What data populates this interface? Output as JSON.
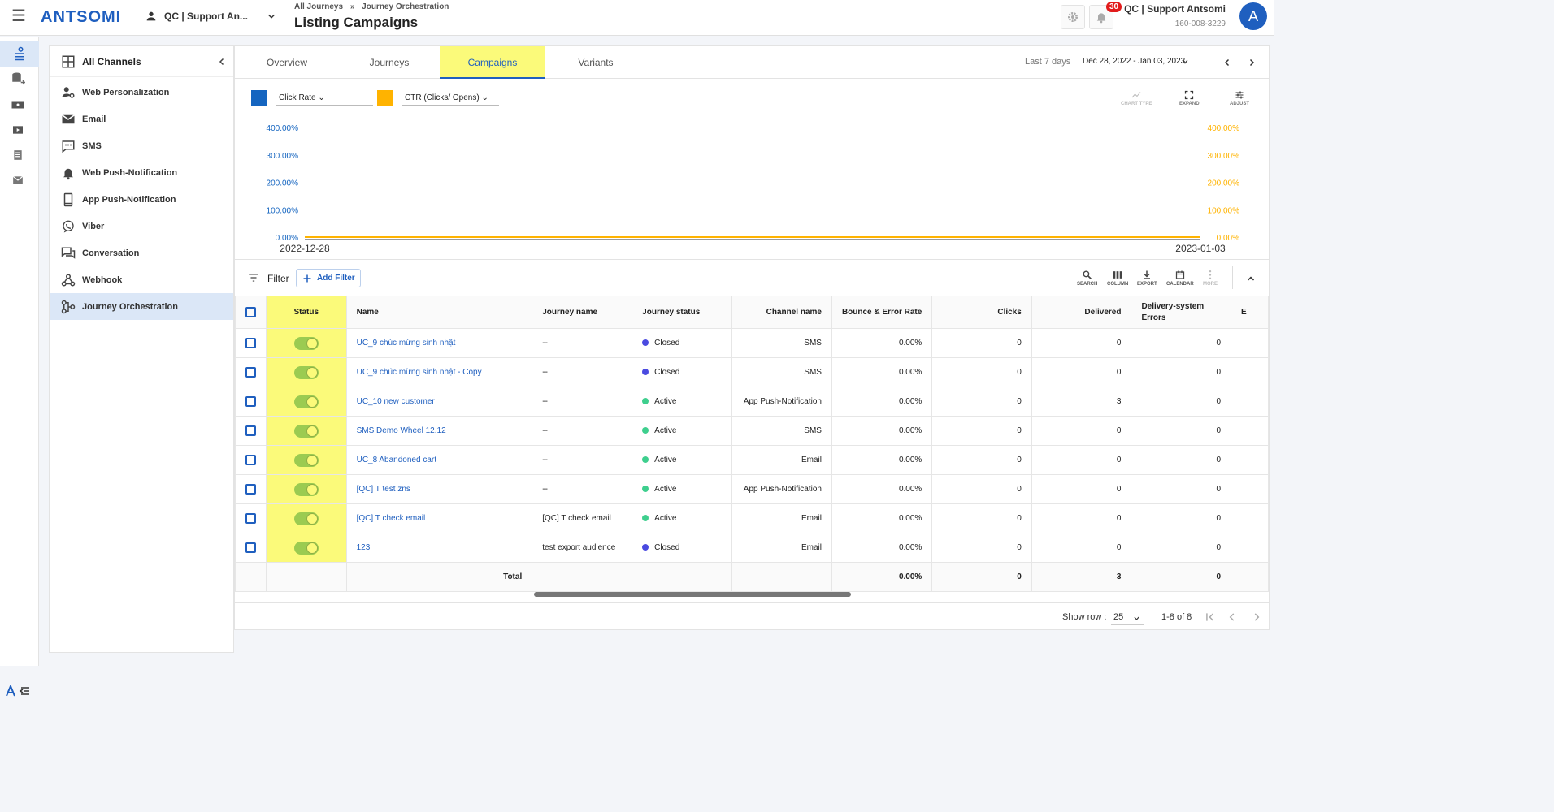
{
  "brand": "ANTSOMI",
  "portal": {
    "name": "QC | Support An..."
  },
  "breadcrumbs": {
    "first": "All Journeys",
    "sep": "»",
    "second": "Journey Orchestration"
  },
  "page_title": "Listing Campaigns",
  "notifications": {
    "count": "30"
  },
  "user": {
    "name": "QC | Support Antsomi",
    "phone": "160-008-3229",
    "initial": "A"
  },
  "channels": {
    "title": "All Channels",
    "items": [
      {
        "label": "Web Personalization",
        "icon": "web-personalization-icon"
      },
      {
        "label": "Email",
        "icon": "email-icon"
      },
      {
        "label": "SMS",
        "icon": "sms-icon"
      },
      {
        "label": "Web Push-Notification",
        "icon": "bell-icon"
      },
      {
        "label": "App Push-Notification",
        "icon": "phone-icon"
      },
      {
        "label": "Viber",
        "icon": "viber-icon"
      },
      {
        "label": "Conversation",
        "icon": "chat-icon"
      },
      {
        "label": "Webhook",
        "icon": "webhook-icon"
      },
      {
        "label": "Journey Orchestration",
        "icon": "journey-icon"
      }
    ]
  },
  "tabs": [
    "Overview",
    "Journeys",
    "Campaigns",
    "Variants"
  ],
  "active_tab": "Campaigns",
  "date_range": {
    "label": "Last 7 days",
    "value": "Dec 28, 2022 - Jan 03, 2023"
  },
  "metrics": [
    {
      "label": "Click Rate",
      "color": "#1565c0"
    },
    {
      "label": "CTR (Clicks/ Opens)",
      "color": "#ffb300"
    }
  ],
  "chart_tools": [
    "CHART TYPE",
    "EXPAND",
    "ADJUST"
  ],
  "chart_data": {
    "type": "line",
    "x": [
      "2022-12-28",
      "2023-01-03"
    ],
    "series": [
      {
        "name": "Click Rate",
        "values": [
          0,
          0
        ]
      },
      {
        "name": "CTR (Clicks/ Opens)",
        "values": [
          0,
          0
        ]
      }
    ],
    "ylim": [
      0,
      400
    ],
    "y_ticks_left": [
      "400.00%",
      "300.00%",
      "200.00%",
      "100.00%",
      "0.00%"
    ],
    "y_ticks_right": [
      "400.00%",
      "300.00%",
      "200.00%",
      "100.00%",
      "0.00%"
    ]
  },
  "filter": {
    "label": "Filter",
    "add_label": "Add Filter"
  },
  "table_tools": [
    "SEARCH",
    "COLUMN",
    "EXPORT",
    "CALENDAR",
    "MORE"
  ],
  "table": {
    "headers": [
      "Status",
      "Name",
      "Journey name",
      "Journey status",
      "Channel name",
      "Bounce & Error Rate",
      "Clicks",
      "Delivered",
      "Delivery-system Errors",
      "E"
    ],
    "rows": [
      {
        "name": "UC_9 chúc mừng sinh nhật",
        "journey": "--",
        "jstatus": "Closed",
        "channel": "SMS",
        "bounce": "0.00%",
        "clicks": "0",
        "delivered": "0",
        "errors": "0"
      },
      {
        "name": "UC_9 chúc mừng sinh nhật - Copy",
        "journey": "--",
        "jstatus": "Closed",
        "channel": "SMS",
        "bounce": "0.00%",
        "clicks": "0",
        "delivered": "0",
        "errors": "0"
      },
      {
        "name": "UC_10 new customer",
        "journey": "--",
        "jstatus": "Active",
        "channel": "App Push-Notification",
        "bounce": "0.00%",
        "clicks": "0",
        "delivered": "3",
        "errors": "0"
      },
      {
        "name": "SMS Demo Wheel 12.12",
        "journey": "--",
        "jstatus": "Active",
        "channel": "SMS",
        "bounce": "0.00%",
        "clicks": "0",
        "delivered": "0",
        "errors": "0"
      },
      {
        "name": "UC_8 Abandoned cart",
        "journey": "--",
        "jstatus": "Active",
        "channel": "Email",
        "bounce": "0.00%",
        "clicks": "0",
        "delivered": "0",
        "errors": "0"
      },
      {
        "name": "[QC] T test zns",
        "journey": "--",
        "jstatus": "Active",
        "channel": "App Push-Notification",
        "bounce": "0.00%",
        "clicks": "0",
        "delivered": "0",
        "errors": "0"
      },
      {
        "name": "[QC] T check email",
        "journey": "[QC] T check email",
        "jstatus": "Active",
        "channel": "Email",
        "bounce": "0.00%",
        "clicks": "0",
        "delivered": "0",
        "errors": "0"
      },
      {
        "name": "123",
        "journey": "test export audience",
        "jstatus": "Closed",
        "channel": "Email",
        "bounce": "0.00%",
        "clicks": "0",
        "delivered": "0",
        "errors": "0"
      }
    ],
    "total": {
      "label": "Total",
      "bounce": "0.00%",
      "clicks": "0",
      "delivered": "3",
      "errors": "0"
    }
  },
  "pager": {
    "show_row_label": "Show row :",
    "rows_per_page": "25",
    "range": "1-8 of 8"
  },
  "status_colors": {
    "Closed": "#4a4ae0",
    "Active": "#3ecf8e"
  }
}
